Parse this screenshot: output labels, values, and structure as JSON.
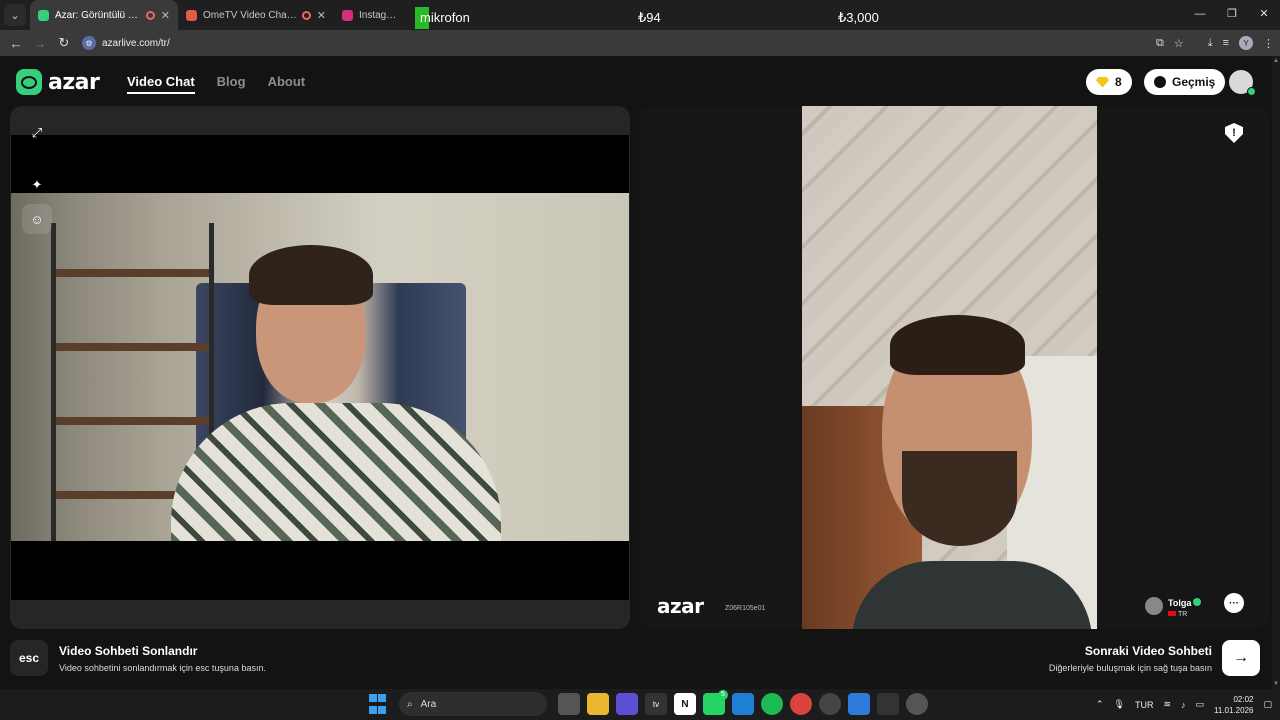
{
  "browser": {
    "tabs": [
      {
        "title": "Azar: Görüntülü Sohbet & V",
        "active": true,
        "fav_color": "#36d07c"
      },
      {
        "title": "OmeTV Video Chat — Ome",
        "active": false,
        "fav_color": "#e05a4e"
      },
      {
        "title": "Instagram",
        "active": false,
        "fav_color": "#d6307a"
      }
    ],
    "overlay": {
      "label": "mikrofon",
      "price1": "₺94",
      "price2": "₺3,000"
    },
    "url": "azarlive.com/tr/",
    "profile_initial": "Y"
  },
  "header": {
    "logo_text": "azar",
    "nav": [
      {
        "label": "Video Chat",
        "active": true
      },
      {
        "label": "Blog",
        "active": false
      },
      {
        "label": "About",
        "active": false
      }
    ],
    "gem_count": "8",
    "history_label": "Geçmiş"
  },
  "remote": {
    "watermark": "azar",
    "watermark_id": "Z06R105e01",
    "partner_name": "Tolga",
    "partner_country": "TR"
  },
  "hints": {
    "esc_key": "esc",
    "end_title": "Video Sohbeti Sonlandır",
    "end_sub": "Video sohbetini sonlandırmak için esc tuşuna basın.",
    "next_title": "Sonraki Video Sohbeti",
    "next_sub": "Diğerleriyle buluşmak için sağ tuşa basın"
  },
  "taskbar": {
    "search_placeholder": "Ara",
    "language": "TUR",
    "time": "02:02",
    "date": "11.01.2026",
    "whatsapp_badge": "5"
  },
  "colors": {
    "brand": "#36d07c",
    "background": "#131313",
    "panel": "#262626"
  }
}
